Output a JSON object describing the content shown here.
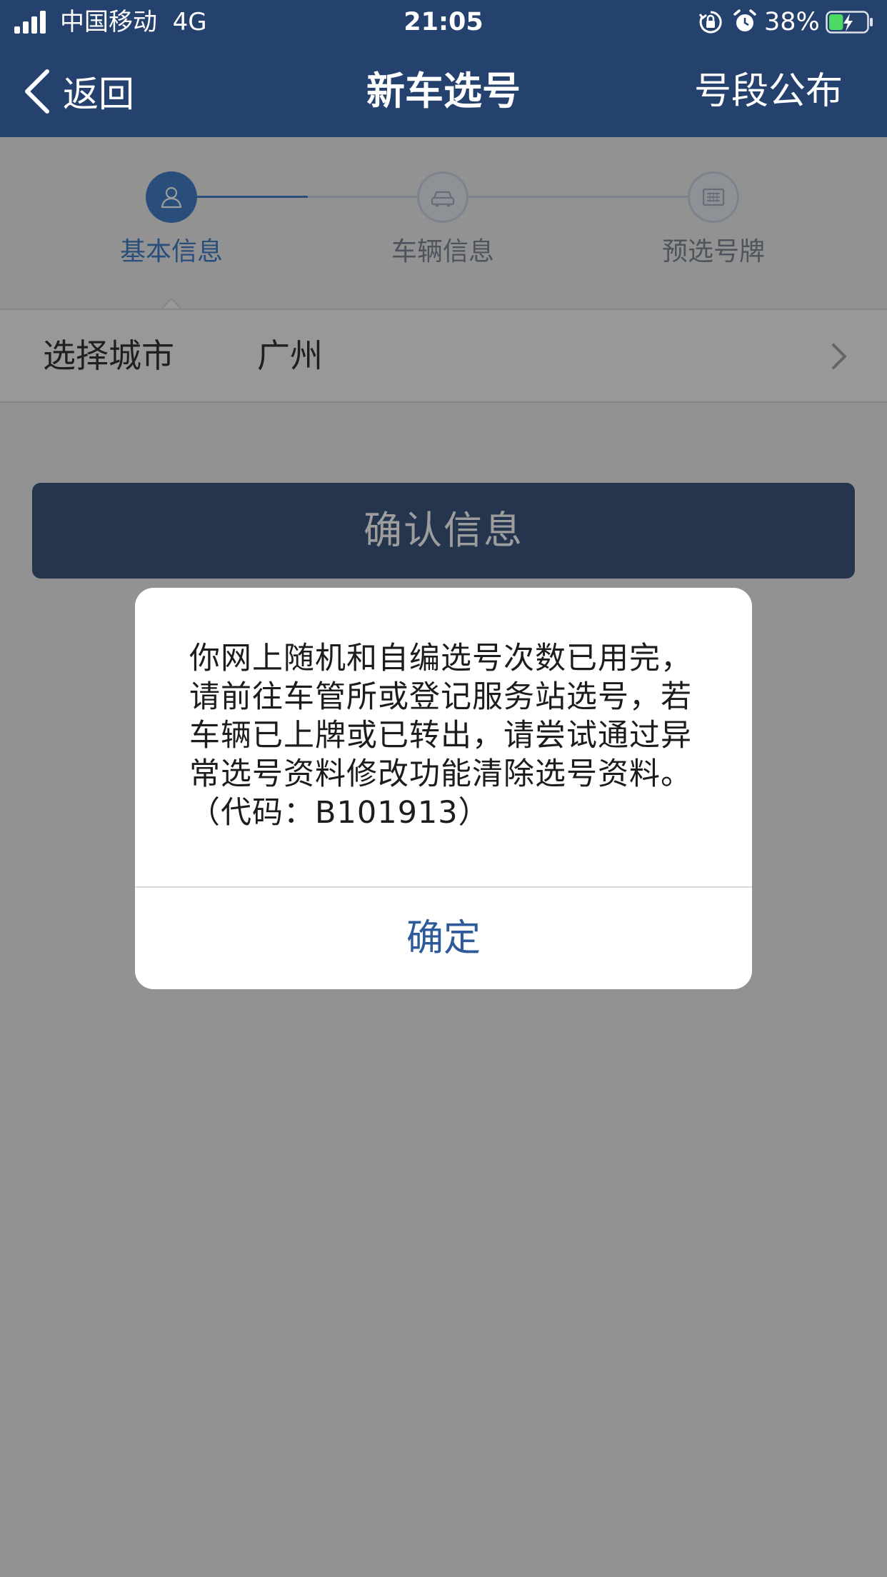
{
  "status_bar": {
    "carrier": "中国移动",
    "network": "4G",
    "time": "21:05",
    "battery_percent": "38%",
    "battery_level": 0.38
  },
  "nav": {
    "back_label": "返回",
    "title": "新车选号",
    "right_action": "号段公布"
  },
  "stepper": {
    "active_index": 0,
    "steps": [
      {
        "label": "基本信息",
        "icon": "person-icon"
      },
      {
        "label": "车辆信息",
        "icon": "car-icon"
      },
      {
        "label": "预选号牌",
        "icon": "plate-icon"
      }
    ]
  },
  "form": {
    "city_label": "选择城市",
    "city_value": "广州"
  },
  "confirm_button": "确认信息",
  "dialog": {
    "message": "你网上随机和自编选号次数已用完，请前往车管所或登记服务站选号，若车辆已上牌或已转出，请尝试通过异常选号资料修改功能清除选号资料。（代码：B101913）",
    "ok_button": "确定"
  },
  "colors": {
    "brand_navy": "#25426e",
    "active_step": "#2f6fc2",
    "dialog_button_text": "#2d5a9a",
    "battery_fill": "#4cd964"
  }
}
